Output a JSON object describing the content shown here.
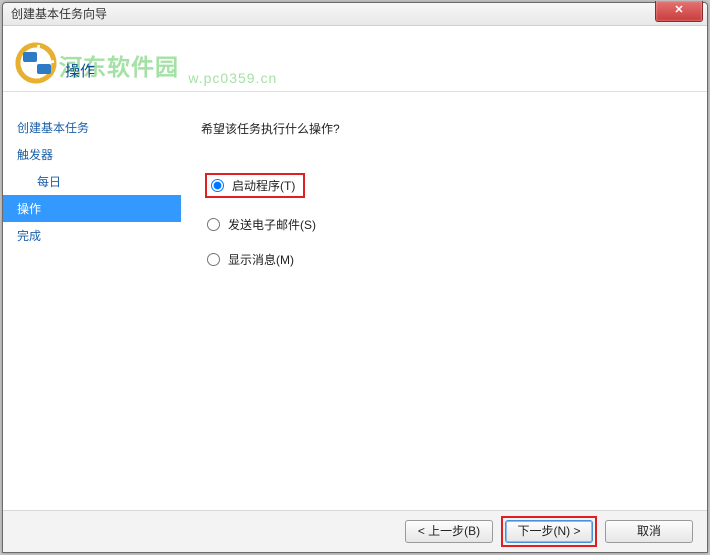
{
  "window": {
    "title": "创建基本任务向导"
  },
  "header": {
    "title": "操作"
  },
  "watermark": {
    "text": "河东软件园",
    "url": "w.pc0359.cn"
  },
  "sidebar": {
    "items": [
      {
        "label": "创建基本任务",
        "type": "item",
        "selected": false
      },
      {
        "label": "触发器",
        "type": "item",
        "selected": false
      },
      {
        "label": "每日",
        "type": "subitem",
        "selected": false
      },
      {
        "label": "操作",
        "type": "item",
        "selected": true
      },
      {
        "label": "完成",
        "type": "item",
        "selected": false
      }
    ]
  },
  "content": {
    "question": "希望该任务执行什么操作?",
    "options": [
      {
        "label": "启动程序(T)",
        "checked": true,
        "highlighted": true
      },
      {
        "label": "发送电子邮件(S)",
        "checked": false,
        "highlighted": false
      },
      {
        "label": "显示消息(M)",
        "checked": false,
        "highlighted": false
      }
    ]
  },
  "footer": {
    "back": "< 上一步(B)",
    "next": "下一步(N) >",
    "cancel": "取消"
  }
}
